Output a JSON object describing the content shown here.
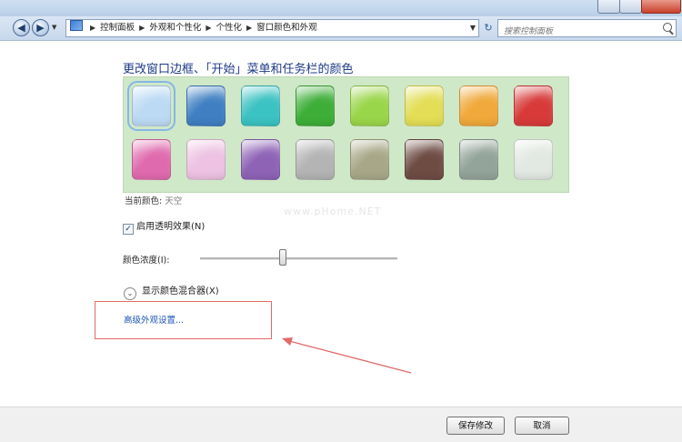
{
  "address_bar": {
    "crumbs": [
      "控制面板",
      "外观和个性化",
      "个性化",
      "窗口颜色和外观"
    ],
    "search_placeholder": "搜索控制面板"
  },
  "main": {
    "heading": "更改窗口边框、「开始」菜单和任务栏的颜色",
    "swatches": [
      {
        "name": "sky",
        "color": "#bcdaf4"
      },
      {
        "name": "twilight",
        "color": "#3f7fc2"
      },
      {
        "name": "sea",
        "color": "#3bc2c2"
      },
      {
        "name": "leaf",
        "color": "#3dae38"
      },
      {
        "name": "lime",
        "color": "#9ad64a"
      },
      {
        "name": "lemon",
        "color": "#e3de55"
      },
      {
        "name": "orange",
        "color": "#f0a93a"
      },
      {
        "name": "red",
        "color": "#d83a3a"
      },
      {
        "name": "fuchsia",
        "color": "#e06aae"
      },
      {
        "name": "blush",
        "color": "#edc2e2"
      },
      {
        "name": "violet",
        "color": "#8e63b6"
      },
      {
        "name": "gray",
        "color": "#b4b4b4"
      },
      {
        "name": "khaki",
        "color": "#a8a888"
      },
      {
        "name": "chocolate",
        "color": "#6e4c44"
      },
      {
        "name": "slate",
        "color": "#93a49a"
      },
      {
        "name": "frost",
        "color": "#e2e8e2"
      }
    ],
    "current_color_label": "当前颜色:",
    "current_color_value": "天空",
    "transparency_label": "启用透明效果(N)",
    "intensity_label": "颜色浓度(I):",
    "intensity_level": 0.42,
    "mixer_label": "显示颜色混合器(X)",
    "advanced_link": "高级外观设置..."
  },
  "footer": {
    "save_label": "保存修改",
    "cancel_label": "取消"
  },
  "colors": {
    "heading": "#1e3a8a",
    "link": "#1d56b4",
    "palette_bg": "#cfe8c8",
    "annotation_red": "#e26a6a"
  }
}
